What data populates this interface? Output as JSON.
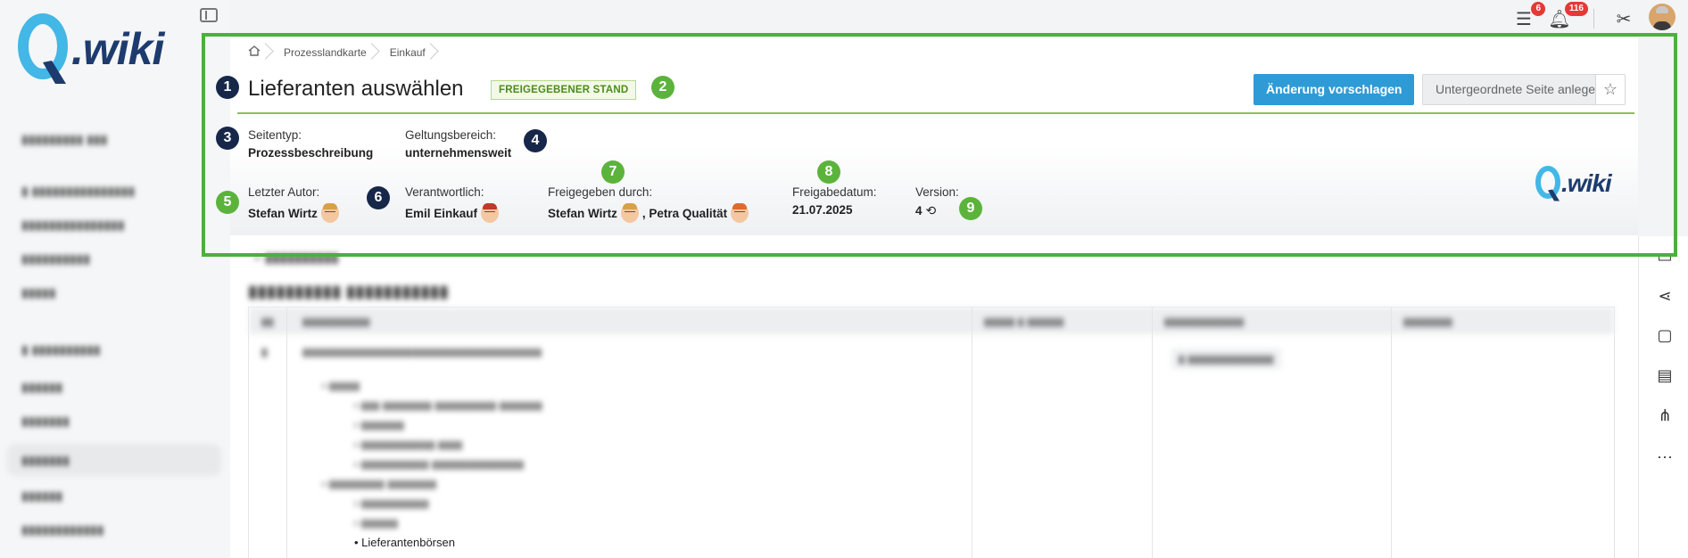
{
  "brand": {
    "logo_q": "Q",
    "logo_text": ".wiki",
    "colors": {
      "accent": "#2f9bd6",
      "highlight": "#4caf3e",
      "marker_dark": "#17274a",
      "marker_green": "#5cb33c"
    }
  },
  "topbar": {
    "tasks_badge": "6",
    "notifications_badge": "116"
  },
  "breadcrumb": {
    "home_icon": "home-icon",
    "items": [
      "Prozesslandkarte",
      "Einkauf"
    ]
  },
  "page": {
    "title": "Lieferanten auswählen",
    "status": "FREIGEGEBENER STAND",
    "suggest_button": "Änderung vorschlagen",
    "subpage_button": "Untergeordnete Seite anlegen"
  },
  "meta": {
    "page_type_label": "Seitentyp:",
    "page_type_value": "Prozessbeschreibung",
    "scope_label": "Geltungsbereich:",
    "scope_value": "unternehmensweit",
    "last_author_label": "Letzter Autor:",
    "last_author_value": "Stefan Wirtz",
    "responsible_label": "Verantwortlich:",
    "responsible_value": "Emil Einkauf",
    "approved_by_label": "Freigegeben durch:",
    "approved_by_1": "Stefan Wirtz",
    "approved_by_2": ", Petra Qualität",
    "approval_date_label": "Freigabedatum:",
    "approval_date_value": "21.07.2025",
    "version_label": "Version:",
    "version_value": "4"
  },
  "markers": [
    "1",
    "2",
    "3",
    "4",
    "5",
    "6",
    "7",
    "8",
    "9"
  ],
  "body": {
    "visible_list_item": "Lieferantenbörsen"
  }
}
